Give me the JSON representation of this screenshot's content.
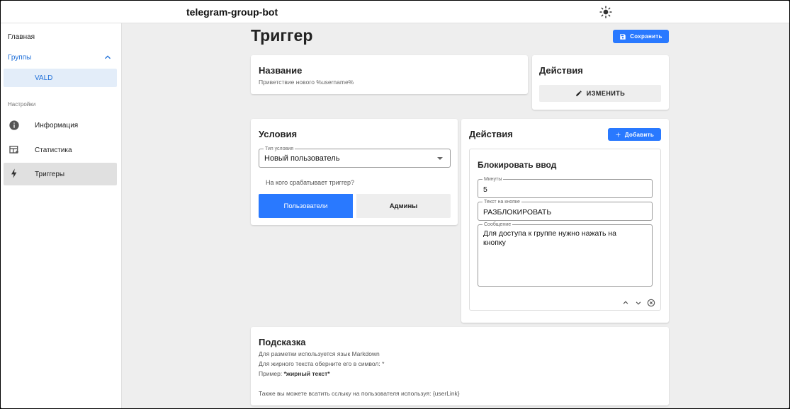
{
  "app": {
    "title": "telegram-group-bot"
  },
  "sidebar": {
    "home": "Главная",
    "groups": "Группы",
    "group_item": "VALD",
    "settings_section": "Настройки",
    "info": "Информация",
    "stats": "Статистика",
    "triggers": "Триггеры"
  },
  "page": {
    "title": "Триггер",
    "save_label": "Сохранить"
  },
  "name_card": {
    "title": "Название",
    "value": "Приветствие нового %username%"
  },
  "actions_card": {
    "title": "Действия",
    "change_label": "ИЗМЕНИТЬ"
  },
  "conditions": {
    "title": "Условия",
    "type_legend": "Тип условия",
    "type_value": "Новый пользователь",
    "who_label": "На кого срабатывает триггер?",
    "users_label": "Пользователи",
    "admins_label": "Админы"
  },
  "actions_list": {
    "title": "Действия",
    "add_label": "Добавить",
    "item": {
      "title": "Блокировать ввод",
      "minutes_legend": "Минуты",
      "minutes_value": "5",
      "button_text_legend": "Текст на кнопке",
      "button_text_value": "РАЗБЛОКИРОВАТЬ",
      "message_legend": "Сообщение",
      "message_value": "Для доступа к группе нужно нажать на кнопку"
    }
  },
  "hint": {
    "title": "Подсказка",
    "line1": "Для разметки используется язык Markdown",
    "line2": "Для жирного текста оберните его в символ: *",
    "line3_prefix": "Пример: ",
    "line3_bold": "*жирный текст*",
    "line4": "Также вы можете всатить сслыку на пользователя используя: {userLink}"
  },
  "colors": {
    "accent": "#2979ff",
    "selected_bg": "#e3edf9"
  }
}
